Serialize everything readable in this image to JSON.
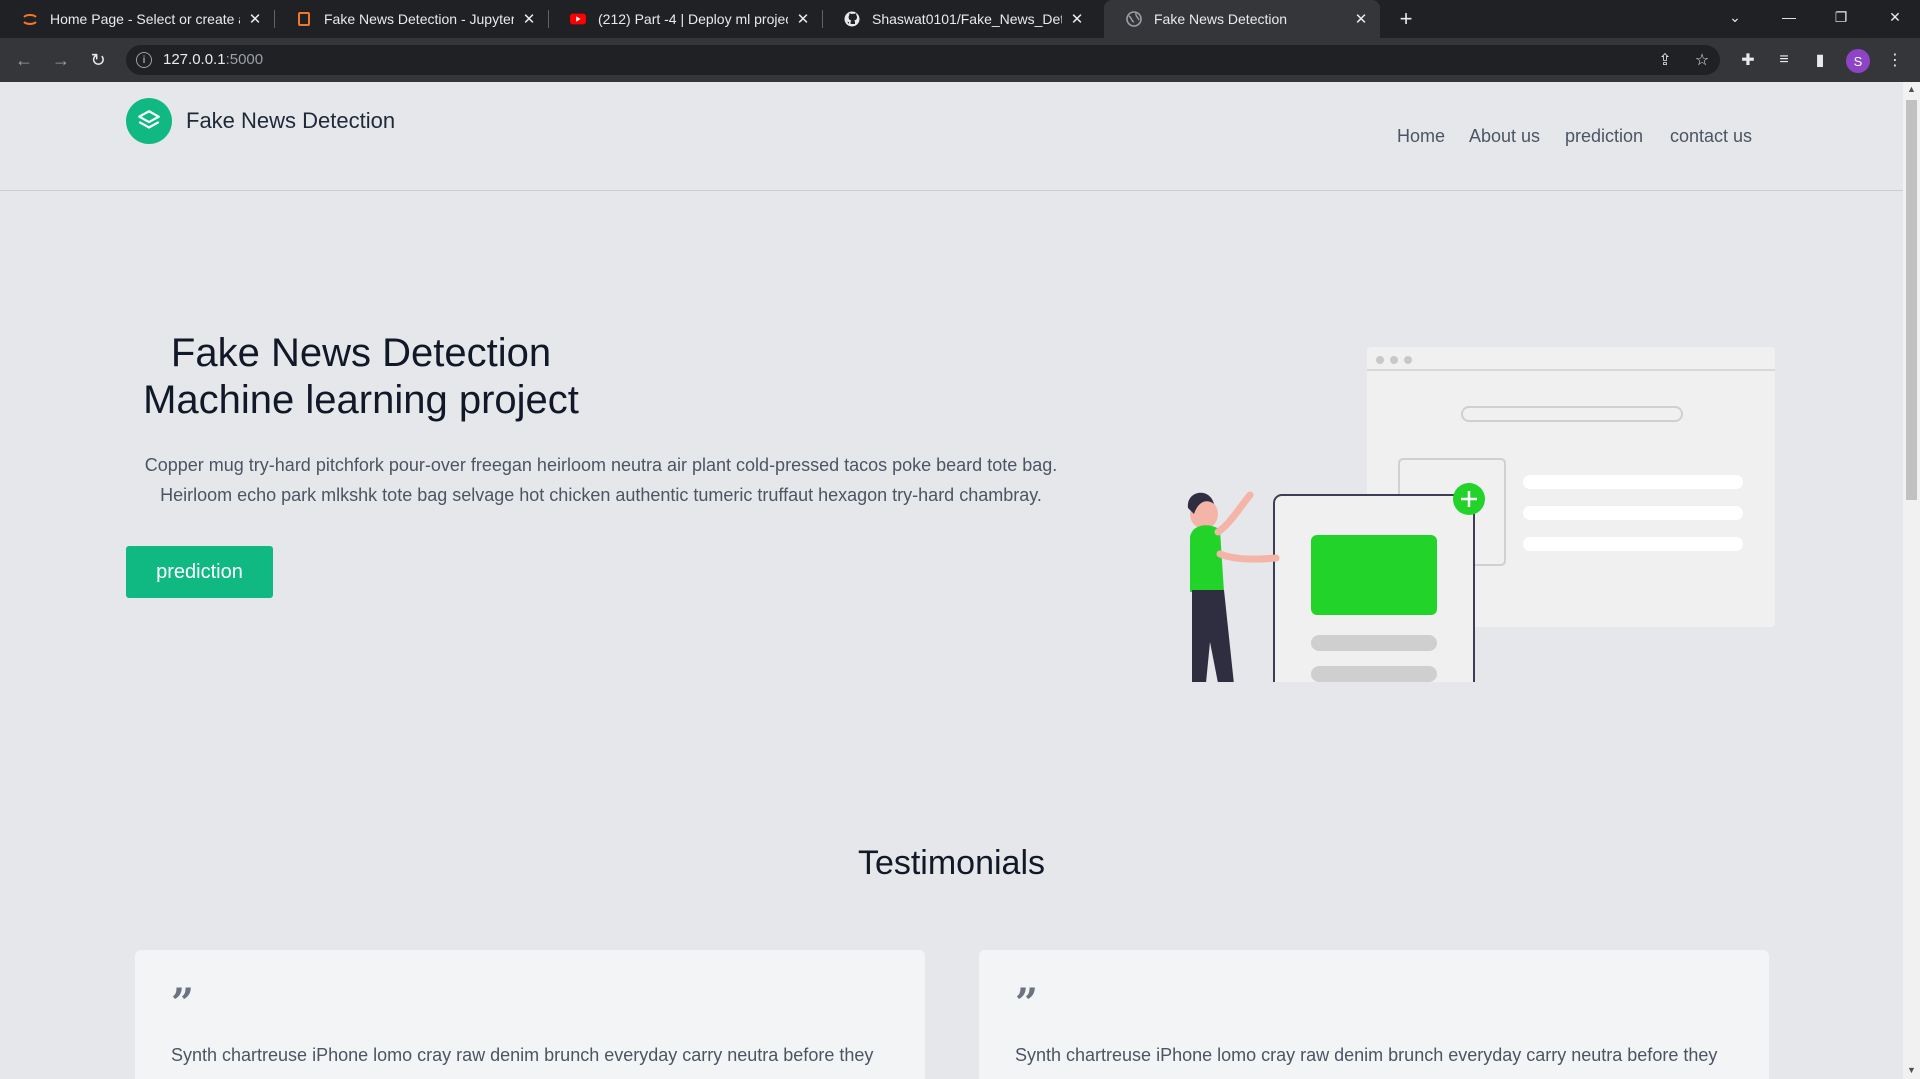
{
  "browser": {
    "tabs": [
      {
        "title": "Home Page - Select or create a n",
        "icon": "jupyter-icon"
      },
      {
        "title": "Fake News Detection - Jupyter N",
        "icon": "notebook-icon"
      },
      {
        "title": "(212) Part -4 | Deploy ml project",
        "icon": "youtube-icon"
      },
      {
        "title": "Shaswat0101/Fake_News_Detecti",
        "icon": "github-icon"
      },
      {
        "title": "Fake News Detection",
        "icon": "globe-icon"
      }
    ],
    "url_host": "127.0.0.1",
    "url_port": ":5000",
    "profile_initial": "S"
  },
  "header": {
    "brand": "Fake News Detection",
    "nav": [
      "Home",
      "About us",
      "prediction",
      "contact us"
    ]
  },
  "hero": {
    "title_line1": "Fake News Detection",
    "title_line2": "Machine learning project",
    "paragraph": "Copper mug try-hard pitchfork pour-over freegan heirloom neutra air plant cold-pressed tacos poke beard tote bag. Heirloom echo park mlkshk tote bag selvage hot chicken authentic tumeric truffaut hexagon try-hard chambray.",
    "button": "prediction"
  },
  "testimonials": {
    "title": "Testimonials",
    "cards": [
      {
        "quote_mark": "”",
        "text": "Synth chartreuse iPhone lomo cray raw denim brunch everyday carry neutra before they"
      },
      {
        "quote_mark": "”",
        "text": "Synth chartreuse iPhone lomo cray raw denim brunch everyday carry neutra before they"
      }
    ]
  },
  "colors": {
    "accent": "#10b981",
    "illustration_green": "#22d32a"
  }
}
